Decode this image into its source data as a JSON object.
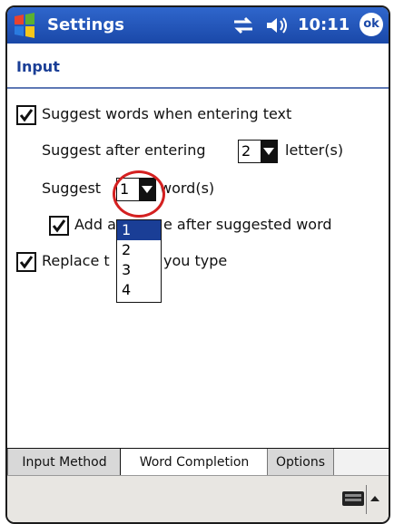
{
  "window": {
    "title": "Settings",
    "time": "10:11",
    "ok_label": "ok"
  },
  "page": {
    "title": "Input"
  },
  "options": {
    "suggest_words": {
      "label": "Suggest words when entering text",
      "checked": true
    },
    "suggest_after": {
      "prefix": "Suggest after entering",
      "value": "2",
      "suffix": "letter(s)"
    },
    "suggest_count": {
      "prefix": "Suggest",
      "value": "1",
      "suffix": "word(s)"
    },
    "add_space": {
      "label_left": "Add a",
      "label_right": "e after suggested word",
      "checked": true
    },
    "replace": {
      "label_left": "Replace t",
      "label_right": "you type",
      "checked": true
    }
  },
  "dropdown": {
    "items": [
      "1",
      "2",
      "3",
      "4"
    ],
    "selected_index": 0
  },
  "tabs": [
    {
      "label": "Input Method",
      "active": false
    },
    {
      "label": "Word Completion",
      "active": true
    },
    {
      "label": "Options",
      "active": false
    }
  ],
  "colors": {
    "titlebar": "#1a48a8",
    "accent": "#1a3e96",
    "highlight": "#d42020"
  },
  "icons": [
    "windows-start-icon",
    "connectivity-icon",
    "speaker-icon",
    "keyboard-icon",
    "sip-arrow-icon",
    "chevron-down-icon",
    "checkmark-icon"
  ]
}
